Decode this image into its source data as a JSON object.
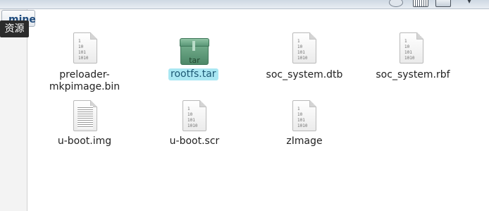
{
  "toolbar": {
    "icons": [
      "disc-icon",
      "keyboard-icon",
      "screen-icon",
      "dropdown-arrow-icon"
    ],
    "arrow_glyph": "▾"
  },
  "breadcrumb": {
    "label": "mine"
  },
  "tooltip": {
    "text": "资源"
  },
  "files": [
    {
      "name": "preloader-",
      "name2": "mkpimage.bin",
      "kind": "binary"
    },
    {
      "name": "rootfs.tar",
      "kind": "tar",
      "badge": "tar",
      "selected": true
    },
    {
      "name": "soc_system.dtb",
      "kind": "binary"
    },
    {
      "name": "soc_system.rbf",
      "kind": "binary"
    },
    {
      "name": "u-boot.img",
      "kind": "text"
    },
    {
      "name": "u-boot.scr",
      "kind": "binary"
    },
    {
      "name": "zImage",
      "kind": "binary"
    }
  ],
  "binary_glyph": "1\n10\n101\n1010",
  "colors": {
    "selection": "#a9e7f3",
    "breadcrumb_text": "#1f4b7d",
    "tar_green": "#5b9878"
  }
}
